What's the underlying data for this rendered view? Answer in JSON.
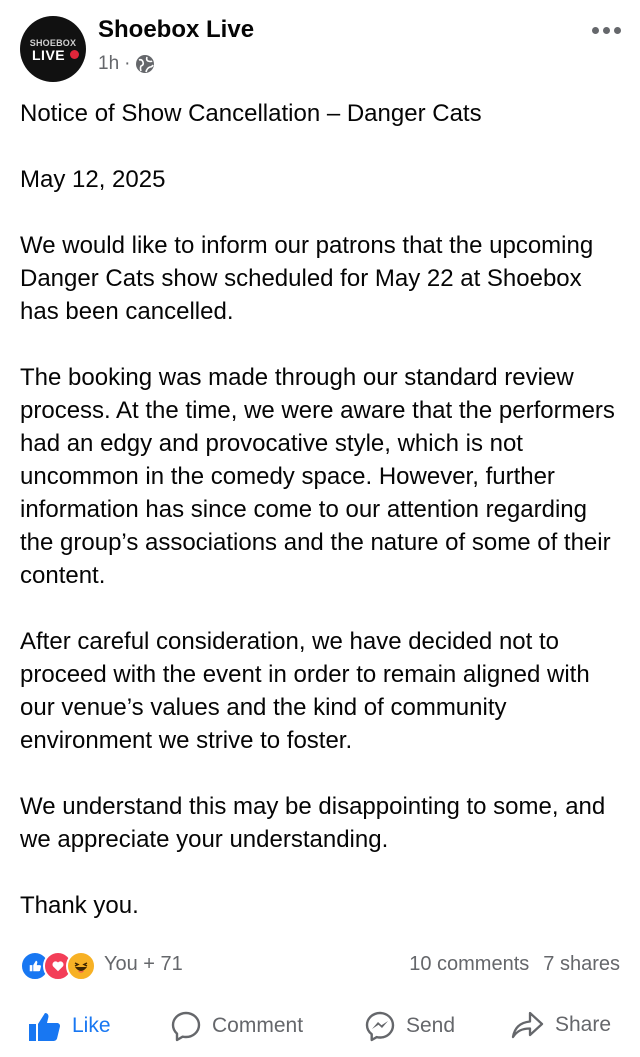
{
  "post": {
    "page_name": "Shoebox Live",
    "avatar": {
      "logo_top": "SHOEBOX",
      "logo_bottom": "LIVE",
      "accent": "#e0263a"
    },
    "time_ago": "1h",
    "separator": "·",
    "audience_icon": "globe-icon",
    "more_icon": "more-options-icon",
    "body": [
      "Notice of Show Cancellation – Danger Cats",
      "May 12, 2025",
      "We would like to inform our patrons that the upcoming Danger Cats show scheduled for May 22 at Shoebox has been cancelled.",
      "The booking was made through our standard review process. At the time, we were aware that the performers had an edgy and provocative style, which is not uncommon in the comedy space. However, further information has since come to our attention regarding the group’s associations and the nature of some of their content.",
      "After careful consideration, we have decided not to proceed with the event in order to remain aligned with our venue’s values and the kind of community environment we strive to foster.",
      "We understand this may be disappointing to some, and we appreciate your understanding.",
      "Thank you."
    ]
  },
  "engagement": {
    "reaction_icons": [
      "like-reaction-icon",
      "love-reaction-icon",
      "haha-reaction-icon"
    ],
    "reaction_text": "You + 71",
    "comments": "10 comments",
    "shares": "7 shares"
  },
  "actions": {
    "like": "Like",
    "comment": "Comment",
    "send": "Send",
    "share": "Share"
  },
  "colors": {
    "primary_blue": "#1877f2",
    "secondary_text": "#65676b",
    "love_red": "#f33e58",
    "haha_yellow": "#f7b125"
  }
}
